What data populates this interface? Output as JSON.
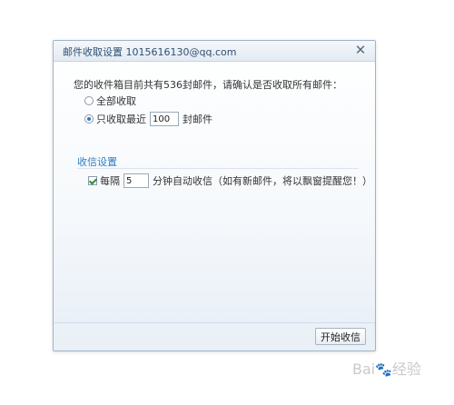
{
  "dialog": {
    "title": "邮件收取设置 1015616130@qq.com",
    "close_glyph": "✕",
    "prompt": "您的收件箱目前共有536封邮件，请确认是否收取所有邮件：",
    "options": [
      {
        "label": "全部收取",
        "checked": false
      },
      {
        "label_before": "只收取最近",
        "value": "100",
        "label_after": "封邮件",
        "checked": true
      }
    ],
    "section_title": "收信设置",
    "auto_check": {
      "checked": true,
      "label_before": "每隔",
      "value": "5",
      "label_after": "分钟自动收信（如有新邮件，将以飘窗提醒您！）"
    },
    "start_button": "开始收信"
  },
  "watermark": {
    "text": "Bai",
    "paw": "🐾",
    "suffix": "经验"
  },
  "colors": {
    "accent": "#2f7cc4",
    "title_text": "#2f4f73",
    "border": "#9fb4c9"
  }
}
